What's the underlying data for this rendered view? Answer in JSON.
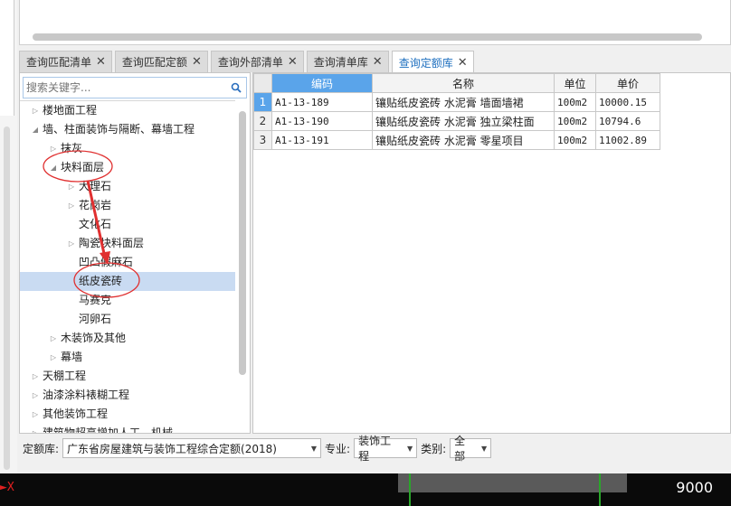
{
  "tabs": [
    {
      "label": "查询匹配清单",
      "active": false
    },
    {
      "label": "查询匹配定额",
      "active": false
    },
    {
      "label": "查询外部清单",
      "active": false
    },
    {
      "label": "查询清单库",
      "active": false
    },
    {
      "label": "查询定额库",
      "active": true
    }
  ],
  "close_glyph": "✕",
  "search": {
    "placeholder": "搜索关键字...",
    "icon": "search-icon"
  },
  "tree": [
    {
      "label": "楼地面工程",
      "level": 0,
      "expanded": false,
      "has_children": true
    },
    {
      "label": "墙、柱面装饰与隔断、幕墙工程",
      "level": 0,
      "expanded": true,
      "has_children": true
    },
    {
      "label": "抹灰",
      "level": 1,
      "expanded": false,
      "has_children": true
    },
    {
      "label": "块料面层",
      "level": 1,
      "expanded": true,
      "has_children": true
    },
    {
      "label": "大理石",
      "level": 2,
      "expanded": false,
      "has_children": true
    },
    {
      "label": "花岗岩",
      "level": 2,
      "expanded": false,
      "has_children": true
    },
    {
      "label": "文化石",
      "level": 2,
      "expanded": false,
      "has_children": false
    },
    {
      "label": "陶瓷块料面层",
      "level": 2,
      "expanded": false,
      "has_children": true
    },
    {
      "label": "凹凸假麻石",
      "level": 2,
      "expanded": false,
      "has_children": false
    },
    {
      "label": "纸皮瓷砖",
      "level": 2,
      "expanded": false,
      "has_children": false,
      "selected": true
    },
    {
      "label": "马赛克",
      "level": 2,
      "expanded": false,
      "has_children": false
    },
    {
      "label": "河卵石",
      "level": 2,
      "expanded": false,
      "has_children": false
    },
    {
      "label": "木装饰及其他",
      "level": 1,
      "expanded": false,
      "has_children": true
    },
    {
      "label": "幕墙",
      "level": 1,
      "expanded": false,
      "has_children": true
    },
    {
      "label": "天棚工程",
      "level": 0,
      "expanded": false,
      "has_children": true
    },
    {
      "label": "油漆涂料裱糊工程",
      "level": 0,
      "expanded": false,
      "has_children": true
    },
    {
      "label": "其他装饰工程",
      "level": 0,
      "expanded": false,
      "has_children": true
    },
    {
      "label": "建筑物超高增加人工、机械",
      "level": 0,
      "expanded": false,
      "has_children": true
    }
  ],
  "grid": {
    "columns": [
      "编码",
      "名称",
      "单位",
      "单价"
    ],
    "rows": [
      {
        "num": "1",
        "code": "A1-13-189",
        "name": "镶贴纸皮瓷砖 水泥膏 墙面墙裙",
        "unit": "100m2",
        "price": "10000.15"
      },
      {
        "num": "2",
        "code": "A1-13-190",
        "name": "镶贴纸皮瓷砖 水泥膏 独立梁柱面",
        "unit": "100m2",
        "price": "10794.6"
      },
      {
        "num": "3",
        "code": "A1-13-191",
        "name": "镶贴纸皮瓷砖 水泥膏 零星项目",
        "unit": "100m2",
        "price": "11002.89"
      }
    ]
  },
  "filters": {
    "quota_lib_label": "定额库:",
    "quota_lib_value": "广东省房屋建筑与装饰工程综合定额(2018)",
    "major_label": "专业:",
    "major_value": "装饰工程",
    "category_label": "类别:",
    "category_value": "全部"
  },
  "status": {
    "left_mark": "X",
    "value": "9000"
  },
  "colors": {
    "accent": "#5aa4ea",
    "selected_row": "#c9dbf2",
    "annotation": "#e03030"
  }
}
